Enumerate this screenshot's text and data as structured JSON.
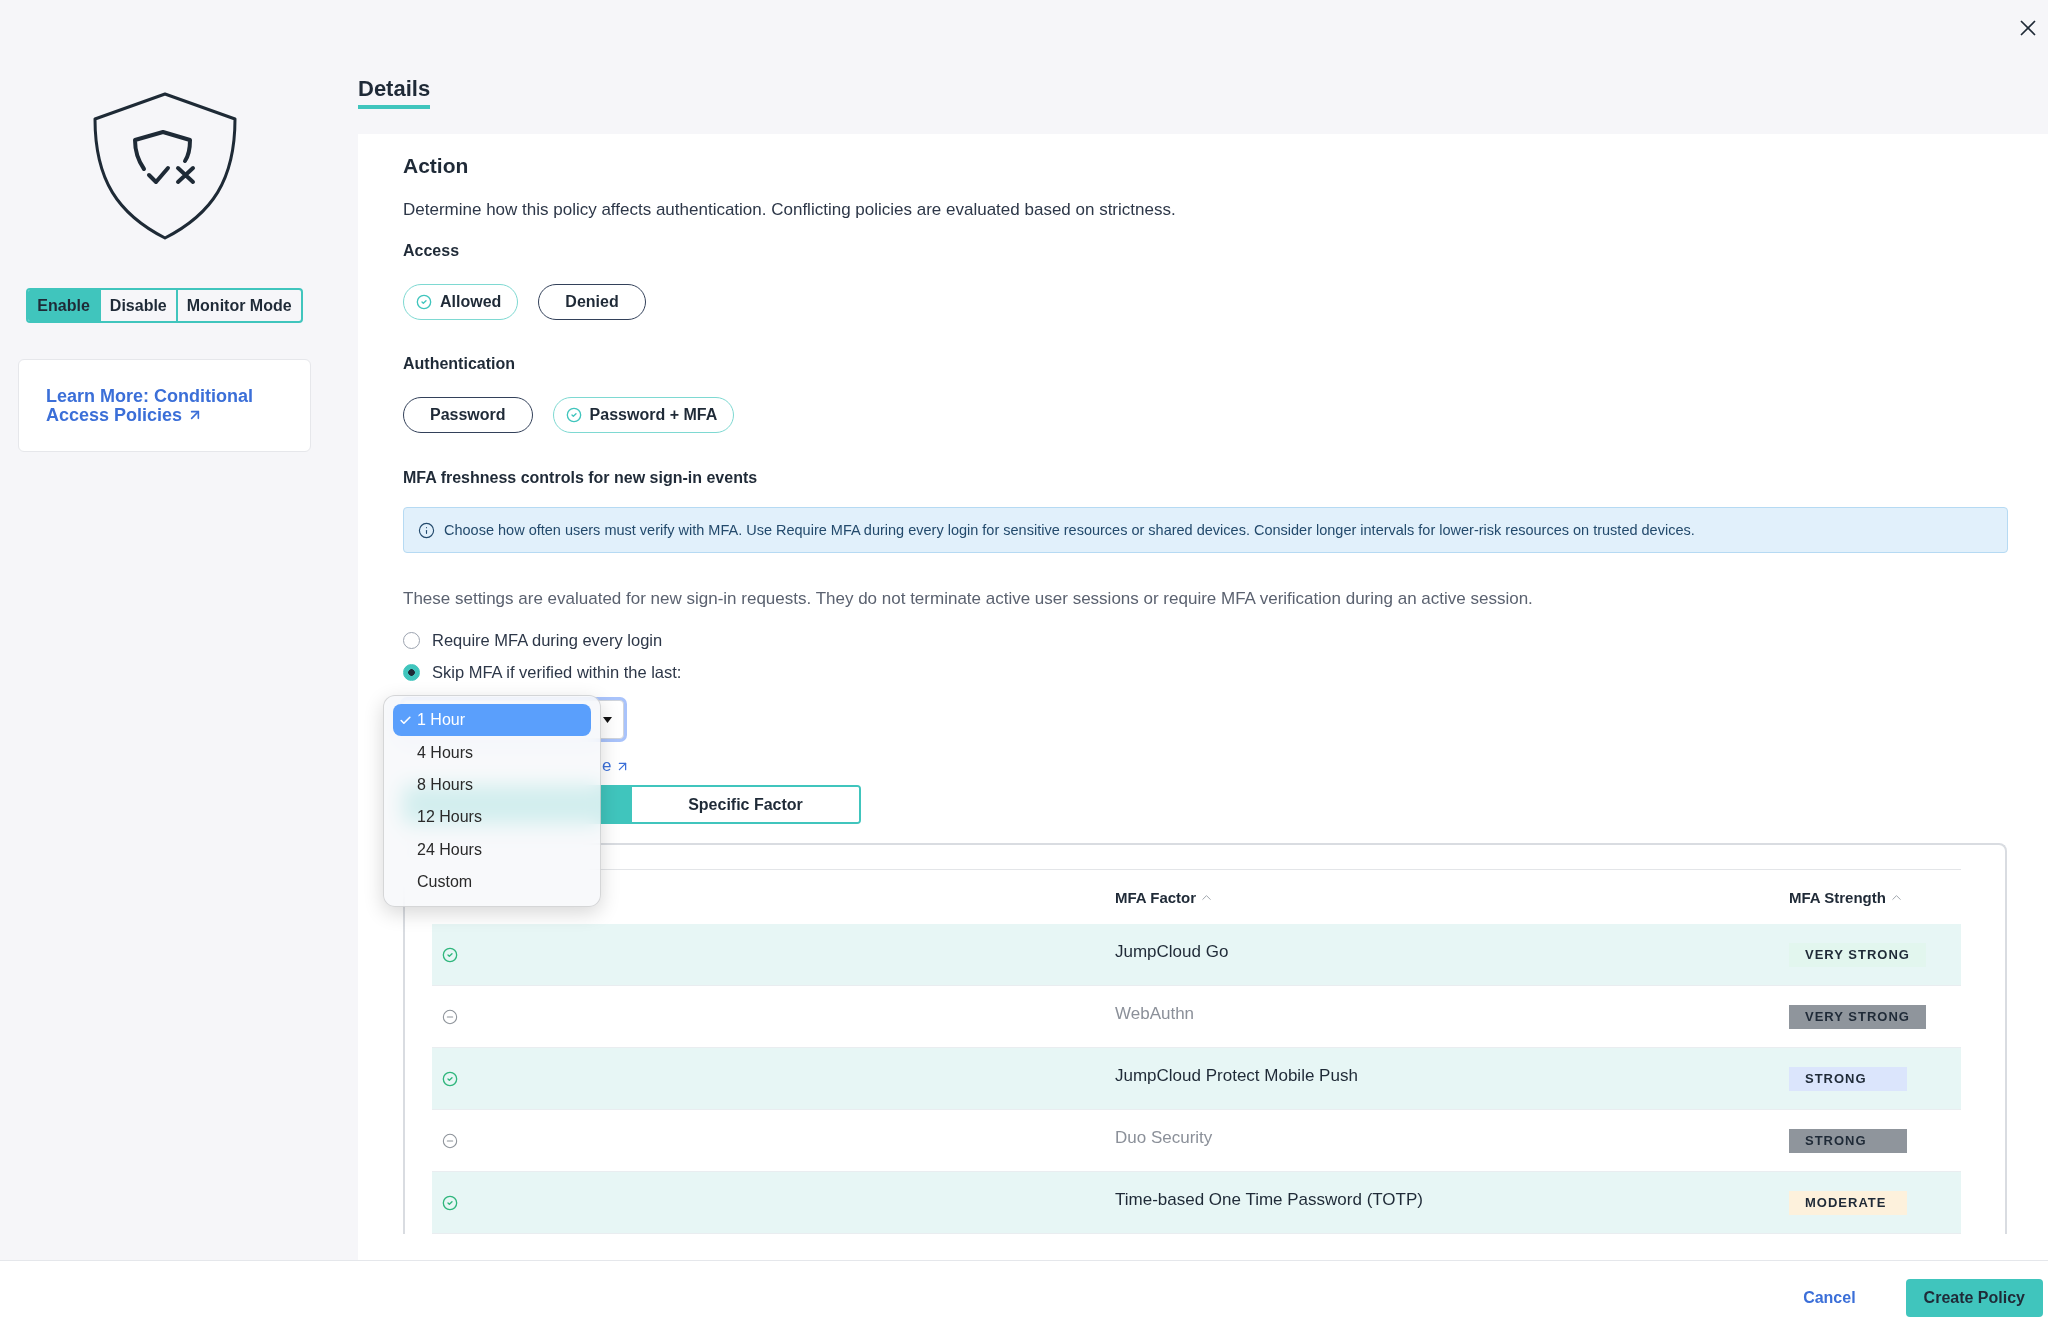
{
  "sidebar": {
    "status_segments": [
      {
        "label": "Enable",
        "selected": true
      },
      {
        "label": "Disable",
        "selected": false
      },
      {
        "label": "Monitor Mode",
        "selected": false
      }
    ],
    "learn_more_link": "Learn More: Conditional Access Policies"
  },
  "tabs": [
    {
      "label": "Details",
      "selected": true
    }
  ],
  "action": {
    "title": "Action",
    "description": "Determine how this policy affects authentication. Conflicting policies are evaluated based on strictness.",
    "access": {
      "label": "Access",
      "options": [
        {
          "label": "Allowed",
          "selected": true
        },
        {
          "label": "Denied",
          "selected": false
        }
      ]
    },
    "authentication": {
      "label": "Authentication",
      "options": [
        {
          "label": "Password",
          "selected": false
        },
        {
          "label": "Password + MFA",
          "selected": true
        }
      ]
    }
  },
  "mfa_freshness": {
    "title": "MFA freshness controls for new sign-in events",
    "info": "Choose how often users must verify with MFA. Use Require MFA during every login for sensitive resources or shared devices. Consider longer intervals for lower-risk resources on trusted devices.",
    "note": "These settings are evaluated for new sign-in requests. They do not terminate active user sessions or require MFA verification during an active session.",
    "options": [
      {
        "label": "Require MFA during every login",
        "selected": false
      },
      {
        "label": "Skip MFA if verified within the last:",
        "selected": true
      }
    ],
    "duration_select": {
      "expanded": true,
      "options": [
        {
          "label": "1 Hour",
          "selected": true
        },
        {
          "label": "4 Hours",
          "selected": false
        },
        {
          "label": "8 Hours",
          "selected": false
        },
        {
          "label": "12 Hours",
          "selected": false
        },
        {
          "label": "24 Hours",
          "selected": false
        },
        {
          "label": "Custom",
          "selected": false
        }
      ]
    },
    "link": "e",
    "factor_tabs": [
      {
        "selected": true
      },
      {
        "label": "Specific Factor",
        "selected": false
      }
    ],
    "table": {
      "columns": [
        {
          "label": "MFA Factor"
        },
        {
          "label": "MFA Strength"
        }
      ],
      "rows": [
        {
          "enabled": true,
          "factor": "JumpCloud Go",
          "strength": {
            "label": "VERY STRONG",
            "color": "#e2f6ee"
          }
        },
        {
          "enabled": false,
          "factor": "WebAuthn",
          "strength": {
            "label": "VERY STRONG",
            "color": "#8f959c"
          }
        },
        {
          "enabled": true,
          "factor": "JumpCloud Protect Mobile Push",
          "strength": {
            "label": "STRONG",
            "color": "#dbe5fc"
          }
        },
        {
          "enabled": false,
          "factor": "Duo Security",
          "strength": {
            "label": "STRONG",
            "color": "#8f959c"
          }
        },
        {
          "enabled": true,
          "factor": "Time-based One Time Password (TOTP)",
          "strength": {
            "label": "MODERATE",
            "color": "#fdf1dc"
          }
        }
      ]
    }
  },
  "footer": {
    "cancel": "Cancel",
    "submit": "Create Policy"
  }
}
